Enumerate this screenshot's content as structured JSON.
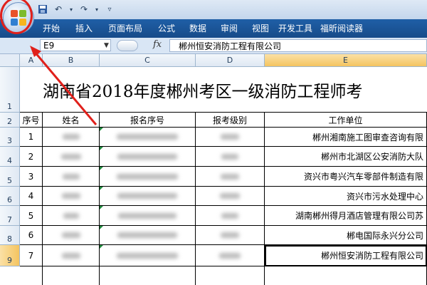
{
  "ribbon_tabs": [
    "开始",
    "插入",
    "页面布局",
    "公式",
    "数据",
    "审阅",
    "视图",
    "开发工具",
    "福昕阅读器"
  ],
  "qat": {
    "save_icon": "save-icon",
    "undo_icon": "undo-icon",
    "redo_icon": "redo-icon",
    "customize_icon": "dropdown-icon"
  },
  "formula": {
    "name_box": "E9",
    "fx_label": "fx",
    "value": "郴州恒安消防工程有限公司"
  },
  "columns": [
    "A",
    "B",
    "C",
    "D",
    "E"
  ],
  "rows": [
    "1",
    "2",
    "3",
    "4",
    "5",
    "6",
    "7",
    "8",
    "9"
  ],
  "sheet": {
    "title": "湖南省2018年度郴州考区一级消防工程师考",
    "headers": [
      "序号",
      "姓名",
      "报名序号",
      "报考级别",
      "工作单位"
    ],
    "records": [
      {
        "no": "1",
        "unit": "郴州湘南施工图审查咨询有限"
      },
      {
        "no": "2",
        "unit": "郴州市北湖区公安消防大队"
      },
      {
        "no": "3",
        "unit": "资兴市粤兴汽车零部件制造有限"
      },
      {
        "no": "4",
        "unit": "资兴市污水处理中心"
      },
      {
        "no": "5",
        "unit": "湖南郴州得月酒店管理有限公司苏"
      },
      {
        "no": "6",
        "unit": "郴电国际永兴分公司"
      },
      {
        "no": "7",
        "unit": "郴州恒安消防工程有限公司"
      }
    ]
  },
  "colors": {
    "ribbon": "#1f5fa7",
    "highlight": "#e0201b",
    "active_header": "#f4c460"
  }
}
